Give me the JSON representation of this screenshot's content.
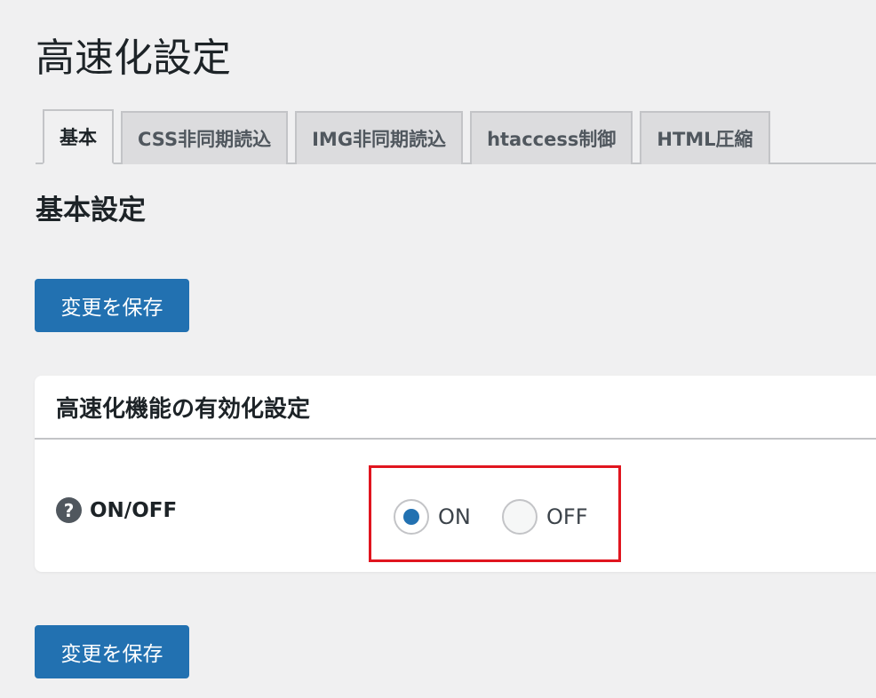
{
  "page": {
    "title": "高速化設定"
  },
  "tabs": [
    {
      "label": "基本",
      "active": true
    },
    {
      "label": "CSS非同期読込",
      "active": false
    },
    {
      "label": "IMG非同期読込",
      "active": false
    },
    {
      "label": "htaccess制御",
      "active": false
    },
    {
      "label": "HTML圧縮",
      "active": false
    }
  ],
  "section": {
    "title": "基本設定"
  },
  "buttons": {
    "save_top": "変更を保存",
    "save_bottom": "変更を保存"
  },
  "settings_card": {
    "title": "高速化機能の有効化設定",
    "help_icon_glyph": "?",
    "row_label": "ON/OFF",
    "options": [
      {
        "label": "ON",
        "checked": true
      },
      {
        "label": "OFF",
        "checked": false
      }
    ],
    "selected": "ON"
  },
  "colors": {
    "background": "#f0f0f1",
    "primary_button": "#2271b1",
    "highlight_border": "#e0151f",
    "radio_selected": "#2271b1"
  },
  "icons": {
    "help": "question-circle-icon"
  }
}
